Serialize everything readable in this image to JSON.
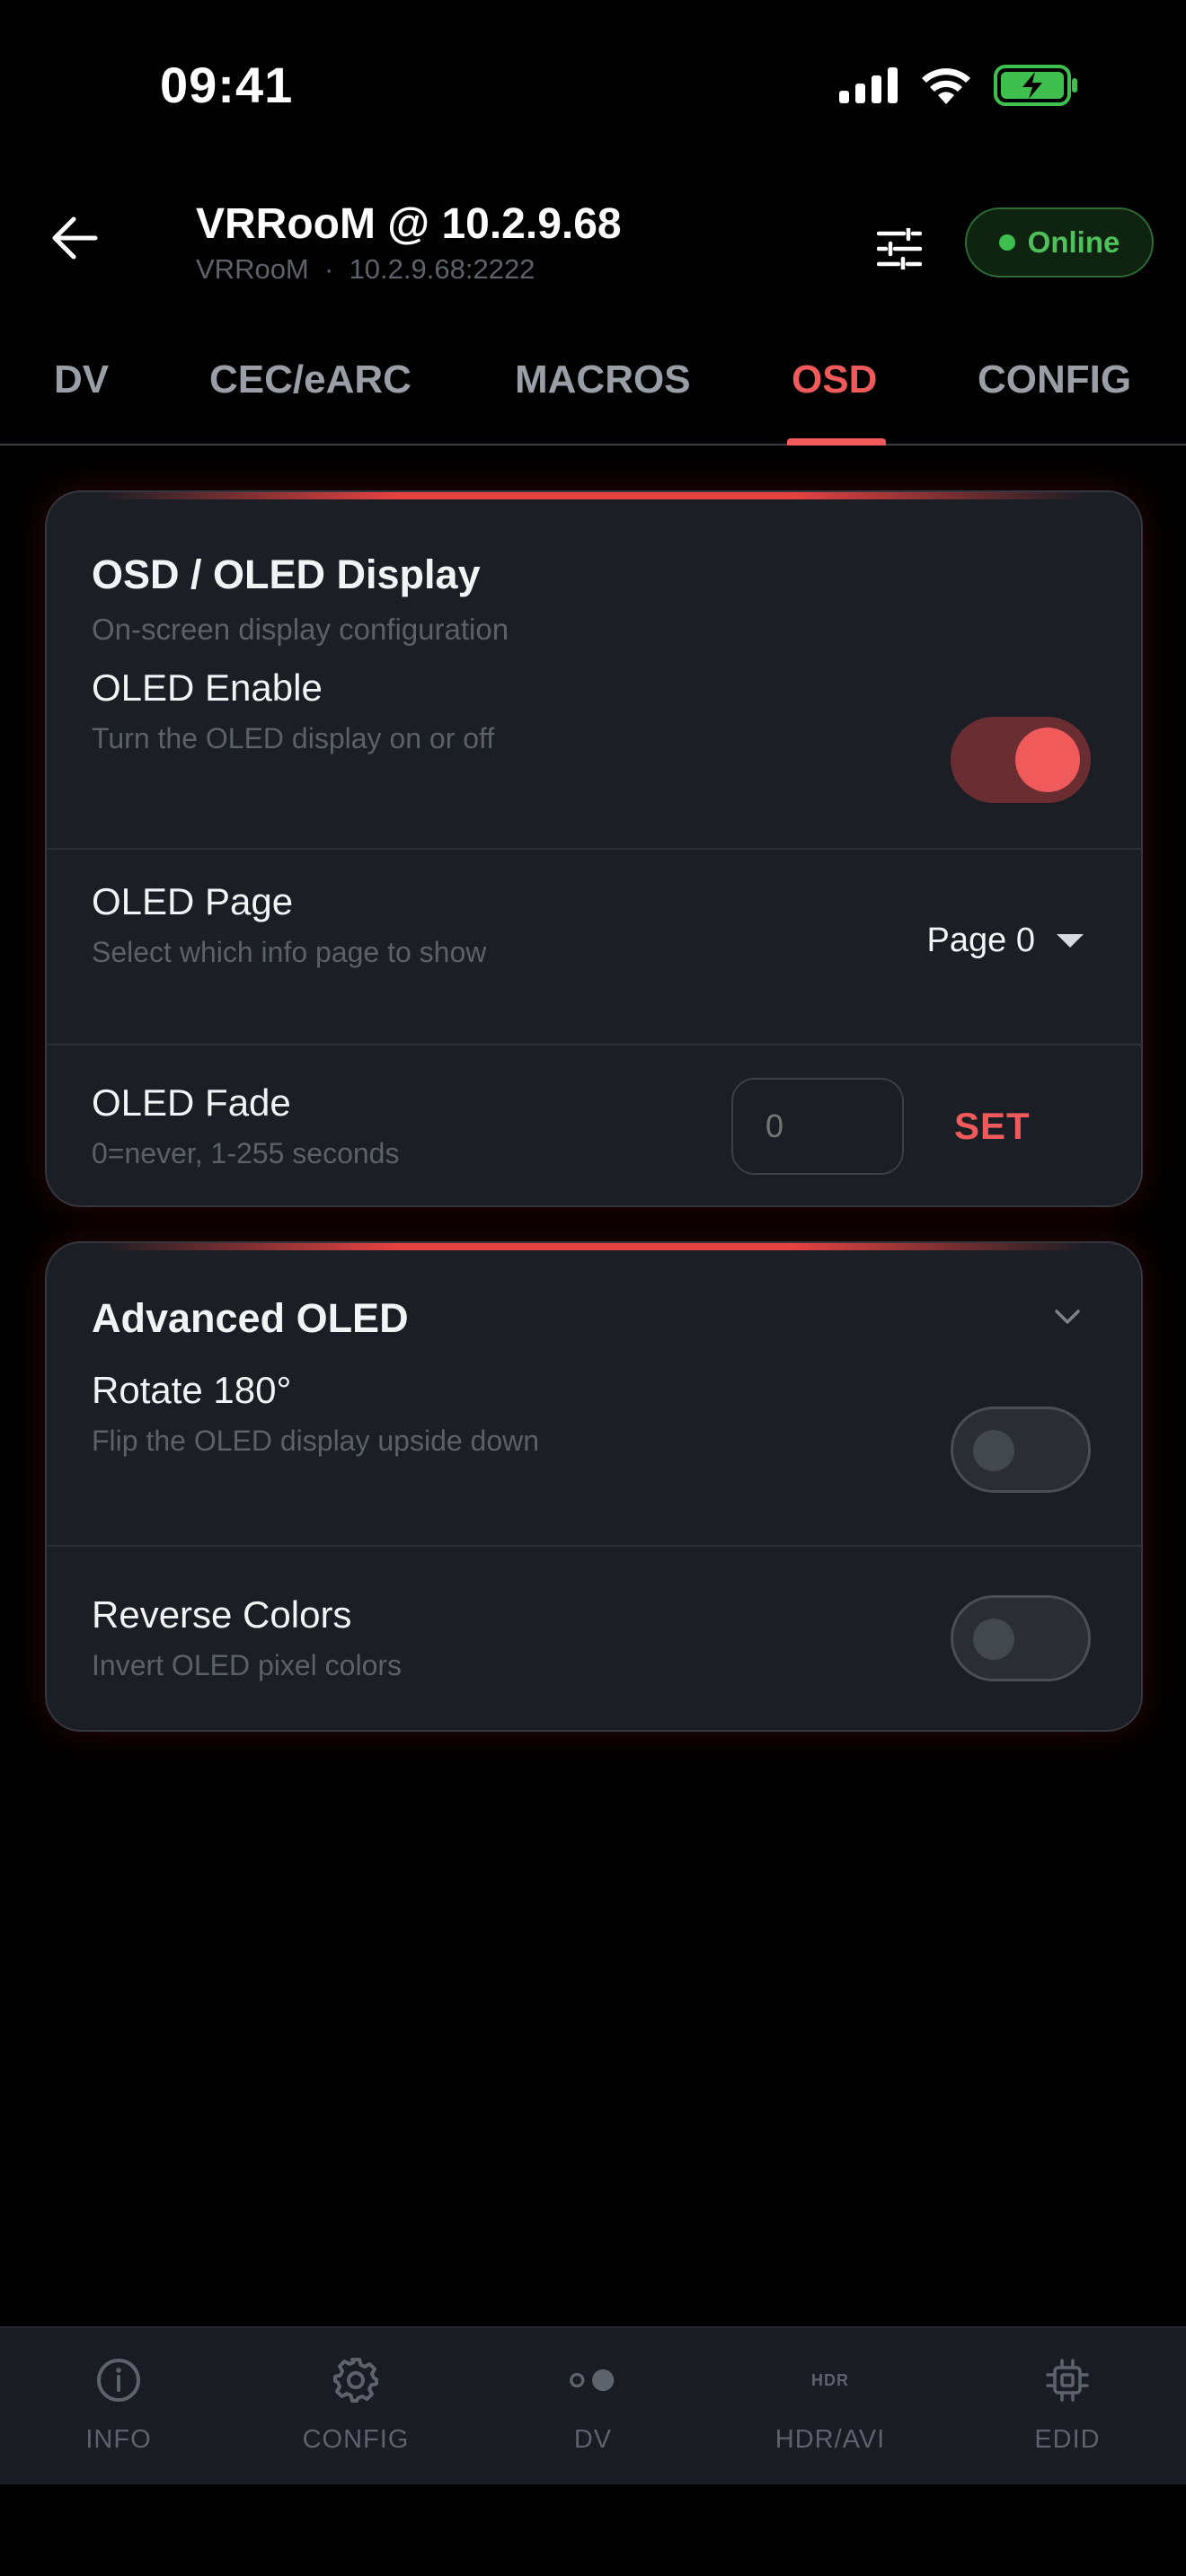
{
  "status_bar": {
    "time": "09:41"
  },
  "header": {
    "title": "VRRooM @ 10.2.9.68",
    "subtitle_name": "VRRooM",
    "subtitle_separator": "·",
    "subtitle_address": "10.2.9.68:2222",
    "status": "Online"
  },
  "tabs": [
    {
      "label": "DV",
      "active": false
    },
    {
      "label": "CEC/eARC",
      "active": false
    },
    {
      "label": "MACROS",
      "active": false
    },
    {
      "label": "OSD",
      "active": true
    },
    {
      "label": "CONFIG",
      "active": false
    }
  ],
  "osd_card": {
    "title": "OSD / OLED Display",
    "subtitle": "On-screen display configuration",
    "oled_enable": {
      "label": "OLED Enable",
      "description": "Turn the OLED display on or off",
      "value": true
    },
    "oled_page": {
      "label": "OLED Page",
      "description": "Select which info page to show",
      "value": "Page 0"
    },
    "oled_fade": {
      "label": "OLED Fade",
      "description": "0=never, 1-255 seconds",
      "placeholder": "0",
      "button": "SET"
    }
  },
  "advanced_card": {
    "title": "Advanced OLED",
    "rotate": {
      "label": "Rotate 180°",
      "description": "Flip the OLED display upside down",
      "value": false
    },
    "reverse": {
      "label": "Reverse Colors",
      "description": "Invert OLED pixel colors",
      "value": false
    }
  },
  "bottom_nav": [
    {
      "label": "INFO",
      "icon": "info-icon"
    },
    {
      "label": "CONFIG",
      "icon": "gear-icon"
    },
    {
      "label": "DV",
      "icon": "dv-toggle-icon"
    },
    {
      "label": "HDR/AVI",
      "icon": "hdr-icon",
      "icon_text": "HDR"
    },
    {
      "label": "EDID",
      "icon": "chip-icon"
    }
  ],
  "colors": {
    "accent": "#f05a5a",
    "online": "#4fc15b",
    "background": "#000000",
    "card": "#1b1e24"
  }
}
